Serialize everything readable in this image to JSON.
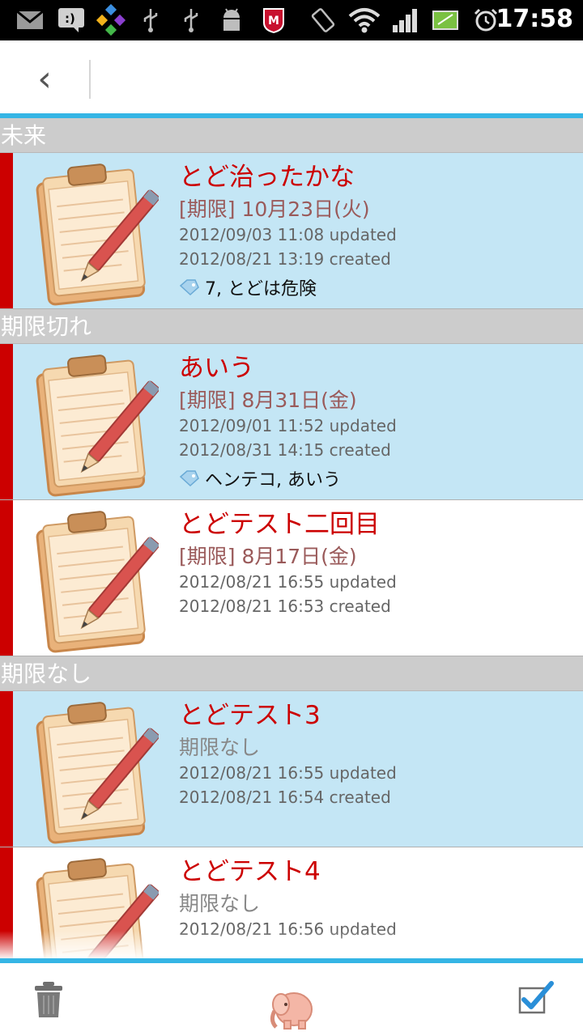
{
  "status_bar": {
    "time": "17:58",
    "icons": [
      "gmail-icon",
      "messenger-icon",
      "app-diamond-icon",
      "usb-icon",
      "usb-icon",
      "android-debug-icon",
      "mcafee-icon",
      "rotation-icon",
      "wifi-icon",
      "signal-icon",
      "battery-icon",
      "alarm-icon"
    ]
  },
  "action_bar": {
    "back_icon": "chevron-left-icon",
    "back_glyph": "‹"
  },
  "sections": [
    {
      "header": "未来",
      "items": [
        {
          "title": "とど治ったかな",
          "deadline": "[期限] 10月23日(火)",
          "updated": "2012/09/03 11:08 updated",
          "created": "2012/08/21 13:19 created",
          "tags": "7, とどは危険"
        }
      ]
    },
    {
      "header": "期限切れ",
      "items": [
        {
          "title": "あいう",
          "deadline": "[期限] 8月31日(金)",
          "updated": "2012/09/01 11:52 updated",
          "created": "2012/08/31 14:15 created",
          "tags": "ヘンテコ, あいう"
        },
        {
          "title": "とどテスト二回目",
          "deadline": "[期限] 8月17日(金)",
          "updated": "2012/08/21 16:55 updated",
          "created": "2012/08/21 16:53 created"
        }
      ]
    },
    {
      "header": "期限なし",
      "items": [
        {
          "title": "とどテスト3",
          "deadline": "期限なし",
          "updated": "2012/08/21 16:55 updated",
          "created": "2012/08/21 16:54 created"
        },
        {
          "title": "とどテスト4",
          "deadline": "期限なし",
          "updated": "2012/08/21 16:56 updated"
        }
      ]
    }
  ],
  "bottom_bar": {
    "icons": [
      "trash-icon",
      "elephant-icon",
      "checkbox-checked-icon"
    ]
  },
  "colors": {
    "accent": "#35b5e5",
    "highlight_row": "#c4e6f5",
    "title_red": "#cc0000",
    "section_bg": "#cccccc",
    "deadline": "#9a5a5a"
  }
}
